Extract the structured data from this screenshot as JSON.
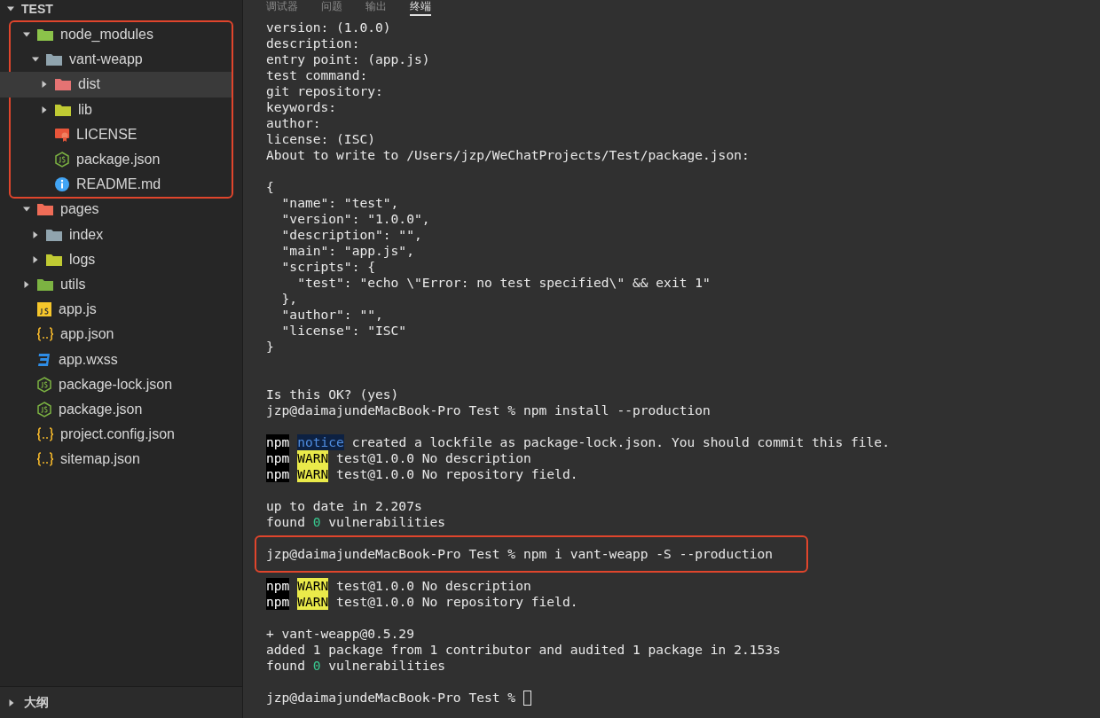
{
  "sidebar": {
    "root": {
      "label": "TEST",
      "expanded": true
    },
    "tree": [
      {
        "label": "node_modules",
        "kind": "folder",
        "color": "#8bc34a",
        "expanded": true,
        "outlined": true,
        "selected": false,
        "children": [
          {
            "label": "vant-weapp",
            "kind": "folder",
            "color": "#90a4ae",
            "expanded": true,
            "selected": false,
            "children": [
              {
                "label": "dist",
                "kind": "folder",
                "color": "#e57373",
                "expanded": false,
                "selected": true
              },
              {
                "label": "lib",
                "kind": "folder",
                "color": "#c0ca33",
                "expanded": false,
                "selected": false
              },
              {
                "label": "LICENSE",
                "kind": "license",
                "selected": false
              },
              {
                "label": "package.json",
                "kind": "node",
                "selected": false
              },
              {
                "label": "README.md",
                "kind": "info",
                "selected": false
              }
            ]
          }
        ]
      },
      {
        "label": "pages",
        "kind": "folder",
        "color": "#ef6c57",
        "expanded": true,
        "selected": false,
        "children": [
          {
            "label": "index",
            "kind": "folder",
            "color": "#90a4ae",
            "expanded": false,
            "selected": false
          },
          {
            "label": "logs",
            "kind": "folder",
            "color": "#c0ca33",
            "expanded": false,
            "selected": false
          }
        ]
      },
      {
        "label": "utils",
        "kind": "folder",
        "color": "#7cb342",
        "expanded": false,
        "selected": false
      },
      {
        "label": "app.js",
        "kind": "js",
        "selected": false
      },
      {
        "label": "app.json",
        "kind": "json",
        "selected": false
      },
      {
        "label": "app.wxss",
        "kind": "css",
        "selected": false
      },
      {
        "label": "package-lock.json",
        "kind": "node",
        "selected": false
      },
      {
        "label": "package.json",
        "kind": "node",
        "selected": false
      },
      {
        "label": "project.config.json",
        "kind": "json",
        "selected": false
      },
      {
        "label": "sitemap.json",
        "kind": "json",
        "selected": false
      }
    ],
    "outline": {
      "label": "大纲",
      "expanded": false
    }
  },
  "panel_tabs": [
    {
      "label": "调试器",
      "selected": false
    },
    {
      "label": "问题",
      "selected": false
    },
    {
      "label": "输出",
      "selected": false
    },
    {
      "label": "终端",
      "selected": true
    }
  ],
  "terminal": {
    "lines": [
      {
        "kind": "text",
        "text": "version: (1.0.0)"
      },
      {
        "kind": "text",
        "text": "description:"
      },
      {
        "kind": "text",
        "text": "entry point: (app.js)"
      },
      {
        "kind": "text",
        "text": "test command:"
      },
      {
        "kind": "text",
        "text": "git repository:"
      },
      {
        "kind": "text",
        "text": "keywords:"
      },
      {
        "kind": "text",
        "text": "author:"
      },
      {
        "kind": "text",
        "text": "license: (ISC)"
      },
      {
        "kind": "text",
        "text": "About to write to /Users/jzp/WeChatProjects/Test/package.json:"
      },
      {
        "kind": "blank"
      },
      {
        "kind": "text",
        "text": "{"
      },
      {
        "kind": "text",
        "text": "  \"name\": \"test\","
      },
      {
        "kind": "text",
        "text": "  \"version\": \"1.0.0\","
      },
      {
        "kind": "text",
        "text": "  \"description\": \"\","
      },
      {
        "kind": "text",
        "text": "  \"main\": \"app.js\","
      },
      {
        "kind": "text",
        "text": "  \"scripts\": {"
      },
      {
        "kind": "text",
        "text": "    \"test\": \"echo \\\"Error: no test specified\\\" && exit 1\""
      },
      {
        "kind": "text",
        "text": "  },"
      },
      {
        "kind": "text",
        "text": "  \"author\": \"\","
      },
      {
        "kind": "text",
        "text": "  \"license\": \"ISC\""
      },
      {
        "kind": "text",
        "text": "}"
      },
      {
        "kind": "blank"
      },
      {
        "kind": "blank"
      },
      {
        "kind": "text",
        "text": "Is this OK? (yes)"
      },
      {
        "kind": "text",
        "text": "jzp@daimajundeMacBook-Pro Test % npm install --production"
      },
      {
        "kind": "blank"
      },
      {
        "kind": "styled",
        "segments": [
          {
            "kind": "npm",
            "text": "npm"
          },
          {
            "kind": "notice",
            "text": "notice"
          },
          {
            "kind": "plain",
            "text": "created a lockfile as package-lock.json. You should commit this file."
          }
        ]
      },
      {
        "kind": "styled",
        "segments": [
          {
            "kind": "npm",
            "text": "npm"
          },
          {
            "kind": "warn",
            "text": "WARN"
          },
          {
            "kind": "plain",
            "text": "test@1.0.0 No description"
          }
        ]
      },
      {
        "kind": "styled",
        "segments": [
          {
            "kind": "npm",
            "text": "npm"
          },
          {
            "kind": "warn",
            "text": "WARN"
          },
          {
            "kind": "plain",
            "text": "test@1.0.0 No repository field."
          }
        ]
      },
      {
        "kind": "blank"
      },
      {
        "kind": "text",
        "text": "up to date in 2.207s"
      },
      {
        "kind": "styled",
        "segments": [
          {
            "kind": "plain",
            "text": "found"
          },
          {
            "kind": "count",
            "text": "0"
          },
          {
            "kind": "plain",
            "text": "vulnerabilities"
          }
        ]
      },
      {
        "kind": "blank"
      },
      {
        "kind": "text",
        "text": "jzp@daimajundeMacBook-Pro Test % npm i vant-weapp -S --production",
        "outlined": true
      },
      {
        "kind": "blank"
      },
      {
        "kind": "styled",
        "segments": [
          {
            "kind": "npm",
            "text": "npm"
          },
          {
            "kind": "warn",
            "text": "WARN"
          },
          {
            "kind": "plain",
            "text": "test@1.0.0 No description"
          }
        ]
      },
      {
        "kind": "styled",
        "segments": [
          {
            "kind": "npm",
            "text": "npm"
          },
          {
            "kind": "warn",
            "text": "WARN"
          },
          {
            "kind": "plain",
            "text": "test@1.0.0 No repository field."
          }
        ]
      },
      {
        "kind": "blank"
      },
      {
        "kind": "text",
        "text": "+ vant-weapp@0.5.29"
      },
      {
        "kind": "text",
        "text": "added 1 package from 1 contributor and audited 1 package in 2.153s"
      },
      {
        "kind": "styled",
        "segments": [
          {
            "kind": "plain",
            "text": "found"
          },
          {
            "kind": "count",
            "text": "0"
          },
          {
            "kind": "plain",
            "text": "vulnerabilities"
          }
        ]
      },
      {
        "kind": "blank"
      },
      {
        "kind": "text",
        "text": "jzp@daimajundeMacBook-Pro Test %",
        "cursor": true
      }
    ]
  }
}
